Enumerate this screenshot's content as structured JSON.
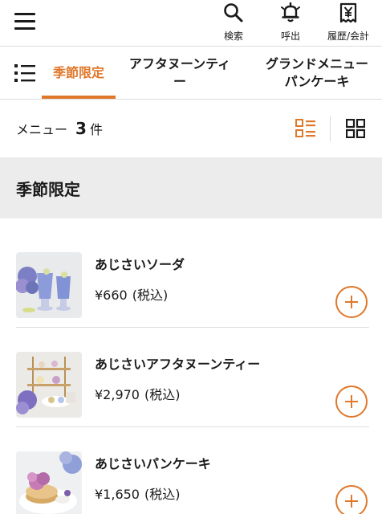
{
  "header": {
    "menu_icon": "hamburger-icon",
    "actions": [
      {
        "label": "検索",
        "icon": "search-icon"
      },
      {
        "label": "呼出",
        "icon": "bell-icon"
      },
      {
        "label": "履歴/会計",
        "icon": "receipt-yen-icon"
      }
    ]
  },
  "tabs": {
    "list_icon": "category-list-icon",
    "items": [
      {
        "line1": "季節限定",
        "line2": "",
        "active": true
      },
      {
        "line1": "アフタヌーンティ",
        "line2": "ー",
        "active": false
      },
      {
        "line1": "グランドメニュー",
        "line2": "パンケーキ",
        "active": false
      }
    ]
  },
  "count_bar": {
    "prefix": "メニュー",
    "count": "3",
    "suffix": "件",
    "list_view_icon": "list-view-icon",
    "grid_view_icon": "grid-view-icon"
  },
  "section": {
    "title": "季節限定"
  },
  "menu_items": [
    {
      "name": "あじさいソーダ",
      "price": "¥660",
      "tax": "(税込)"
    },
    {
      "name": "あじさいアフタヌーンティー",
      "price": "¥2,970",
      "tax": "(税込)"
    },
    {
      "name": "あじさいパンケーキ",
      "price": "¥1,650",
      "tax": "(税込)"
    }
  ],
  "colors": {
    "accent": "#e0782c",
    "section_bg": "#ececec",
    "divider": "#dcdcdc"
  }
}
